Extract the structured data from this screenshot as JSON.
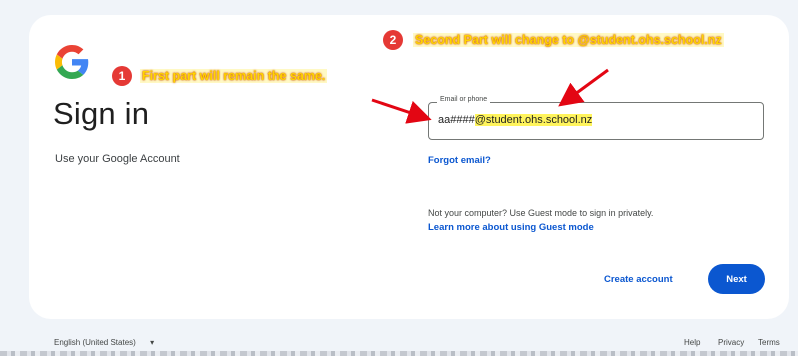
{
  "signin": {
    "title": "Sign in",
    "subtitle": "Use your Google Account",
    "email_label": "Email or phone",
    "email_prefix": "aa####",
    "email_domain": "@student.ohs.school.nz",
    "forgot_email": "Forgot email?",
    "guest_text": "Not your computer? Use Guest mode to sign in privately.",
    "learn_more": "Learn more about using Guest mode",
    "create_account": "Create account",
    "next": "Next"
  },
  "footer": {
    "language": "English (United States)",
    "help": "Help",
    "privacy": "Privacy",
    "terms": "Terms"
  },
  "annotations": [
    {
      "number": "1",
      "text": "First part will remain the same."
    },
    {
      "number": "2",
      "text": "Second Part will change to @student.ohs.school.nz"
    }
  ],
  "colors": {
    "accent": "#0b57d0",
    "highlight": "#fff45c",
    "annotation_badge": "#e53935",
    "annotation_text": "#ffd400"
  },
  "icons": [
    "google-logo-icon",
    "chevron-down-icon"
  ]
}
